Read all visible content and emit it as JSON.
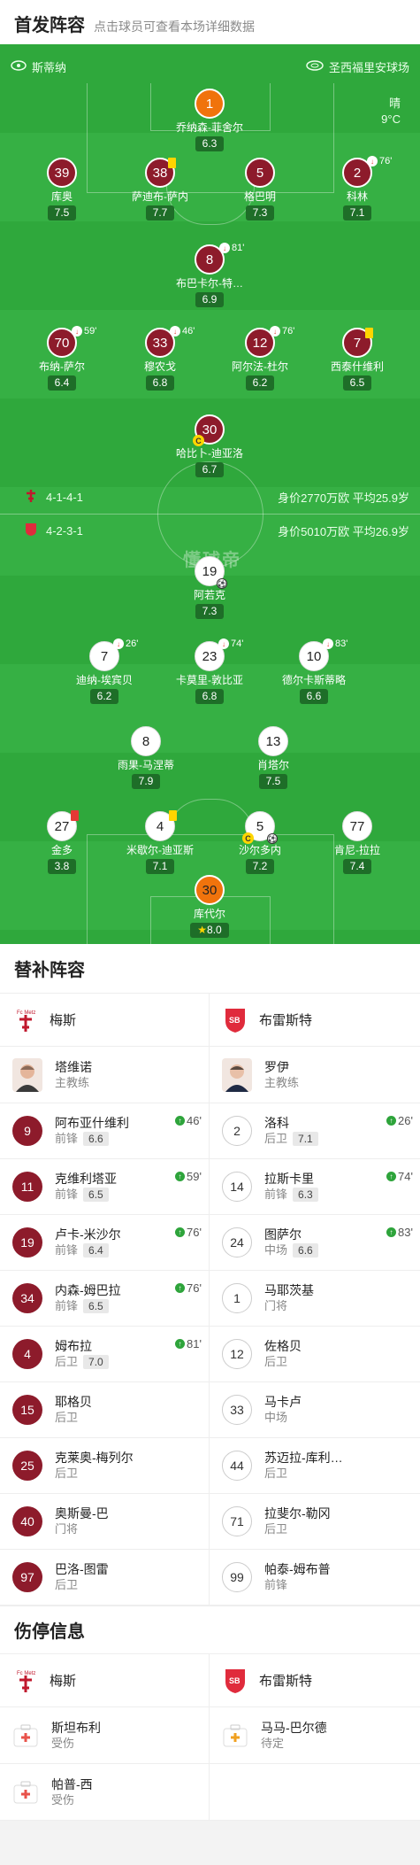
{
  "lineup": {
    "title": "首发阵容",
    "subtitle": "点击球员可查看本场详细数据",
    "home_team": "斯蒂纳",
    "away_team": "圣西福里安球场",
    "weather": "晴",
    "temperature": "9°C",
    "home_formation": "4-1-4-1",
    "home_value": "身价2770万欧  平均25.9岁",
    "away_formation": "4-2-3-1",
    "away_value": "身价5010万欧  平均26.9岁",
    "watermark": "懂球帝"
  },
  "home_players": [
    {
      "num": "1",
      "name": "乔纳森-菲舍尔",
      "rating": "6.3"
    },
    {
      "num": "39",
      "name": "库奥",
      "rating": "7.5"
    },
    {
      "num": "38",
      "name": "萨迪布-萨内",
      "rating": "7.7"
    },
    {
      "num": "5",
      "name": "格巴明",
      "rating": "7.3"
    },
    {
      "num": "2",
      "name": "科林",
      "rating": "7.1",
      "sub": "76'"
    },
    {
      "num": "8",
      "name": "布巴卡尔-特…",
      "rating": "6.9",
      "sub": "81'"
    },
    {
      "num": "70",
      "name": "布纳-萨尔",
      "rating": "6.4",
      "sub": "59'"
    },
    {
      "num": "33",
      "name": "穆农戈",
      "rating": "6.8",
      "sub": "46'"
    },
    {
      "num": "12",
      "name": "阿尔法-杜尔",
      "rating": "6.2",
      "sub": "76'"
    },
    {
      "num": "7",
      "name": "西泰什维利",
      "rating": "6.5"
    },
    {
      "num": "30",
      "name": "哈比卜-迪亚洛",
      "rating": "6.7"
    }
  ],
  "away_players": [
    {
      "num": "19",
      "name": "阿若克",
      "rating": "7.3"
    },
    {
      "num": "7",
      "name": "迪纳-埃宾贝",
      "rating": "6.2",
      "sub": "26'"
    },
    {
      "num": "23",
      "name": "卡莫里-敦比亚",
      "rating": "6.8",
      "sub": "74'"
    },
    {
      "num": "10",
      "name": "德尔卡斯蒂略",
      "rating": "6.6",
      "sub": "83'"
    },
    {
      "num": "8",
      "name": "雨果-马涅蒂",
      "rating": "7.9"
    },
    {
      "num": "13",
      "name": "肖塔尔",
      "rating": "7.5"
    },
    {
      "num": "27",
      "name": "金多",
      "rating": "3.8"
    },
    {
      "num": "4",
      "name": "米歇尔-迪亚斯",
      "rating": "7.1"
    },
    {
      "num": "5",
      "name": "沙尔多内",
      "rating": "7.2"
    },
    {
      "num": "77",
      "name": "肯尼-拉拉",
      "rating": "7.4"
    },
    {
      "num": "30",
      "name": "库代尔",
      "rating": "8.0"
    }
  ],
  "subs": {
    "title": "替补阵容",
    "home_team": "梅斯",
    "away_team": "布雷斯特",
    "home_coach": {
      "name": "塔维诺",
      "role": "主教练"
    },
    "away_coach": {
      "name": "罗伊",
      "role": "主教练"
    },
    "home": [
      {
        "num": "9",
        "name": "阿布亚什维利",
        "pos": "前锋",
        "rating": "6.6",
        "sub": "46'"
      },
      {
        "num": "11",
        "name": "克维利塔亚",
        "pos": "前锋",
        "rating": "6.5",
        "sub": "59'"
      },
      {
        "num": "19",
        "name": "卢卡-米沙尔",
        "pos": "前锋",
        "rating": "6.4",
        "sub": "76'"
      },
      {
        "num": "34",
        "name": "内森-姆巴拉",
        "pos": "前锋",
        "rating": "6.5",
        "sub": "76'"
      },
      {
        "num": "4",
        "name": "姆布拉",
        "pos": "后卫",
        "rating": "7.0",
        "sub": "81'"
      },
      {
        "num": "15",
        "name": "耶格贝",
        "pos": "后卫"
      },
      {
        "num": "25",
        "name": "克莱奥-梅列尔",
        "pos": "后卫"
      },
      {
        "num": "40",
        "name": "奥斯曼-巴",
        "pos": "门将"
      },
      {
        "num": "97",
        "name": "巴洛-图雷",
        "pos": "后卫"
      }
    ],
    "away": [
      {
        "num": "2",
        "name": "洛科",
        "pos": "后卫",
        "rating": "7.1",
        "sub": "26'"
      },
      {
        "num": "14",
        "name": "拉斯卡里",
        "pos": "前锋",
        "rating": "6.3",
        "sub": "74'"
      },
      {
        "num": "24",
        "name": "图萨尔",
        "pos": "中场",
        "rating": "6.6",
        "sub": "83'"
      },
      {
        "num": "1",
        "name": "马耶茨基",
        "pos": "门将"
      },
      {
        "num": "12",
        "name": "佐格贝",
        "pos": "后卫"
      },
      {
        "num": "33",
        "name": "马卡卢",
        "pos": "中场"
      },
      {
        "num": "44",
        "name": "苏迈拉-库利…",
        "pos": "后卫"
      },
      {
        "num": "71",
        "name": "拉斐尔-勒冈",
        "pos": "后卫"
      },
      {
        "num": "99",
        "name": "帕泰-姆布普",
        "pos": "前锋"
      }
    ]
  },
  "injuries": {
    "title": "伤停信息",
    "home_team": "梅斯",
    "away_team": "布雷斯特",
    "home": [
      {
        "name": "斯坦布利",
        "status": "受伤"
      },
      {
        "name": "帕普-西",
        "status": "受伤"
      }
    ],
    "away": [
      {
        "name": "马马-巴尔德",
        "status": "待定"
      }
    ]
  },
  "colors": {
    "pitch": "#2fa83c",
    "home": "#8d1b2b",
    "goalkeeper": "#f0730c"
  }
}
